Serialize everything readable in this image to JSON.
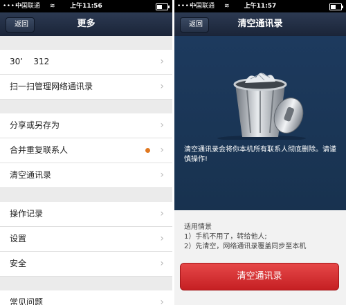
{
  "left": {
    "status": {
      "signal": "•••••",
      "carrier": "中国联通",
      "wifi": "≋",
      "time": "上午11:56"
    },
    "nav": {
      "back": "返回",
      "title": "更多"
    },
    "rows": {
      "account": "30ʼ    312",
      "scan": "扫一扫管理网络通讯录",
      "share": "分享或另存为",
      "merge": "合并重复联系人",
      "clear": "清空通讯录",
      "oplog": "操作记录",
      "settings": "设置",
      "security": "安全",
      "faq": "常见问题"
    },
    "merge_badge_color": "#e07820"
  },
  "right": {
    "status": {
      "signal": "•••••",
      "carrier": "中国联通",
      "wifi": "≋",
      "time": "上午11:57"
    },
    "nav": {
      "back": "返回",
      "title": "清空通讯录"
    },
    "warning": "清空通讯录会将你本机所有联系人彻底删除。请谨慎操作!",
    "info": {
      "heading": "适用情景",
      "line1": "1）手机不用了，转给他人;",
      "line2": "2）先清空，网络通讯录覆盖同步至本机"
    },
    "button": "清空通讯录",
    "button_color": "#d52b2e"
  }
}
